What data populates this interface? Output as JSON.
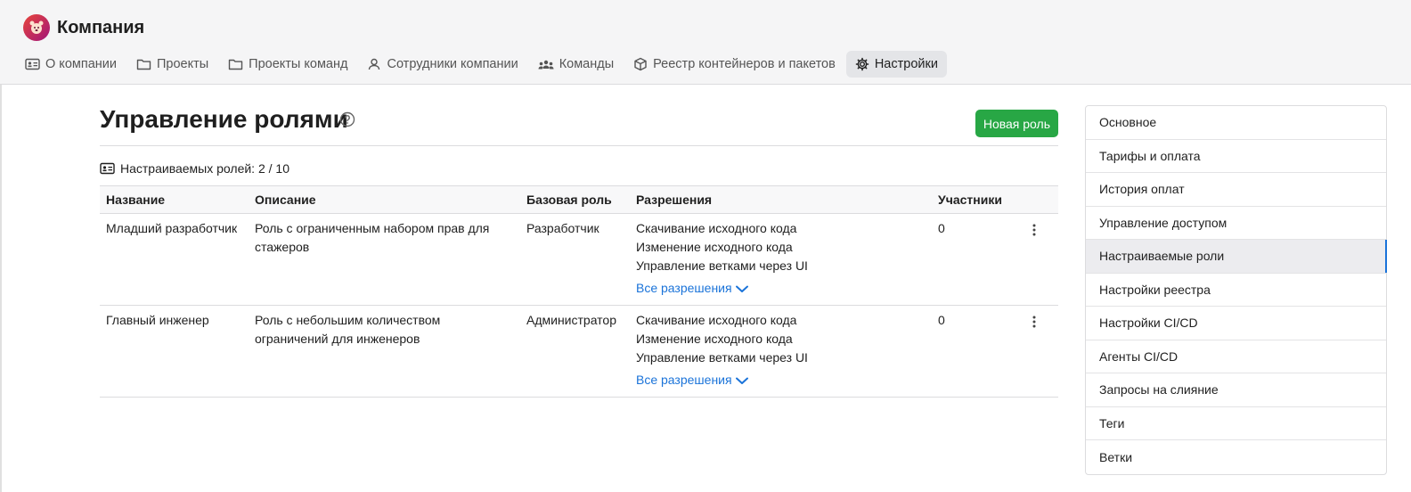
{
  "header": {
    "brand": "Компания",
    "nav": [
      {
        "label": "О компании",
        "icon": "id-card-icon"
      },
      {
        "label": "Проекты",
        "icon": "folder-icon"
      },
      {
        "label": "Проекты команд",
        "icon": "folder-icon"
      },
      {
        "label": "Сотрудники компании",
        "icon": "user-icon"
      },
      {
        "label": "Команды",
        "icon": "team-icon"
      },
      {
        "label": "Реестр контейнеров и пакетов",
        "icon": "package-icon"
      },
      {
        "label": "Настройки",
        "icon": "gear-icon",
        "active": true
      }
    ]
  },
  "main": {
    "title": "Управление ролями",
    "new_role_label": "Новая роль",
    "count_text": "Настраиваемых ролей: 2 / 10",
    "columns": [
      "Название",
      "Описание",
      "Базовая роль",
      "Разрешения",
      "Участники"
    ],
    "rows": [
      {
        "name": "Младший разработчик",
        "description": "Роль с ограниченным набором прав для стажеров",
        "base_role": "Разработчик",
        "permissions": [
          "Скачивание исходного кода",
          "Изменение исходного кода",
          "Управление ветками через UI"
        ],
        "all_permissions_label": "Все разрешения",
        "members": "0"
      },
      {
        "name": "Главный инженер",
        "description": "Роль с небольшим количеством ограничений для инженеров",
        "base_role": "Администратор",
        "permissions": [
          "Скачивание исходного кода",
          "Изменение исходного кода",
          "Управление ветками через UI"
        ],
        "all_permissions_label": "Все разрешения",
        "members": "0"
      }
    ]
  },
  "sidebar": {
    "items": [
      {
        "label": "Основное"
      },
      {
        "label": "Тарифы и оплата"
      },
      {
        "label": "История оплат"
      },
      {
        "label": "Управление доступом"
      },
      {
        "label": "Настраиваемые роли",
        "active": true
      },
      {
        "label": "Настройки реестра"
      },
      {
        "label": "Настройки CI/CD"
      },
      {
        "label": "Агенты CI/CD"
      },
      {
        "label": "Запросы на слияние"
      },
      {
        "label": "Теги"
      },
      {
        "label": "Ветки"
      }
    ]
  },
  "colors": {
    "accent": "#1a73d9",
    "primary_button": "#28a745"
  }
}
